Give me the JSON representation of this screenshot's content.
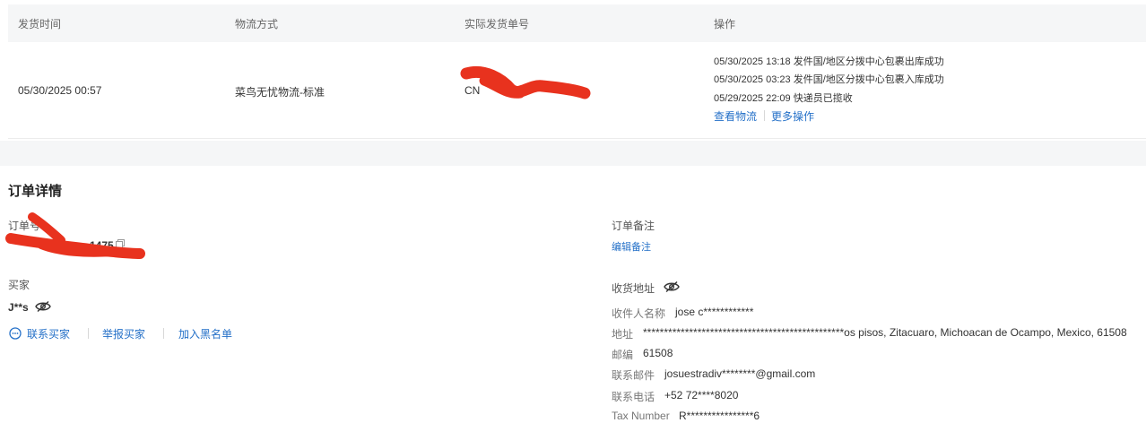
{
  "shipment": {
    "headers": {
      "time": "发货时间",
      "method": "物流方式",
      "tracking": "实际发货单号",
      "actions": "操作"
    },
    "row": {
      "time": "05/30/2025 00:57",
      "method": "菜鸟无忧物流-标准",
      "tracking_prefix": "CN",
      "logs": [
        "05/30/2025 13:18  发件国/地区分拨中心包裹出库成功",
        "05/30/2025 03:23  发件国/地区分拨中心包裹入库成功",
        "05/29/2025 22:09  快递员已揽收"
      ],
      "view_logistics": "查看物流",
      "more_actions": "更多操作"
    }
  },
  "order": {
    "title": "订单详情",
    "order_no_label": "订单号",
    "order_no_tail": "1475",
    "buyer_label": "买家",
    "buyer_name": "J**s",
    "contact_buyer": "联系买家",
    "report_buyer": "举报买家",
    "add_blacklist": "加入黑名单",
    "note_label": "订单备注",
    "edit_note": "编辑备注",
    "address_label": "收货地址",
    "address": {
      "recipient_label": "收件人名称",
      "recipient": "jose c************",
      "addr_label": "地址",
      "addr": "************************************************os pisos, Zitacuaro, Michoacan de Ocampo, Mexico, 61508",
      "zip_label": "邮编",
      "zip": "61508",
      "email_label": "联系邮件",
      "email": "josuestradiv********@gmail.com",
      "phone_label": "联系电话",
      "phone": "+52 72****8020",
      "tax_label": "Tax Number",
      "tax": "R****************6"
    }
  },
  "colors": {
    "link": "#2470c8",
    "redaction": "#e8321e",
    "header_bg": "#f5f6f7"
  }
}
